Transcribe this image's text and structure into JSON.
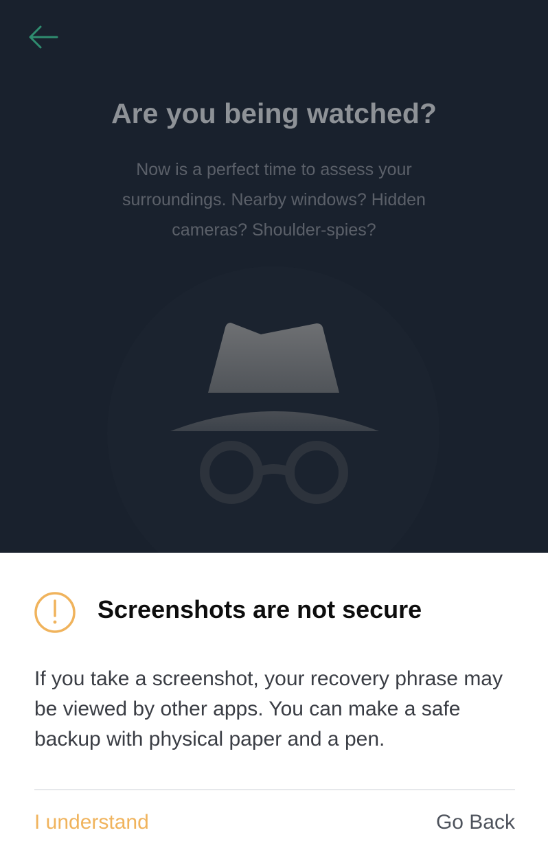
{
  "screen": {
    "title": "Are you being watched?",
    "subtitle": "Now is a perfect time to assess your surroundings. Nearby windows? Hidden cameras? Shoulder-spies?",
    "back_icon": "arrow-left-icon",
    "illustration_icon": "incognito-spy-icon"
  },
  "sheet": {
    "icon": "warning-circle-icon",
    "title": "Screenshots are not secure",
    "body": "If you take a screenshot, your recovery phrase may be viewed by other apps. You can make a safe backup with physical paper and a pen.",
    "primary_label": "I understand",
    "secondary_label": "Go Back"
  },
  "colors": {
    "background": "#19212d",
    "accent_green": "#2f8c6f",
    "warning_orange": "#f0b35c",
    "sheet_background": "#ffffff"
  }
}
